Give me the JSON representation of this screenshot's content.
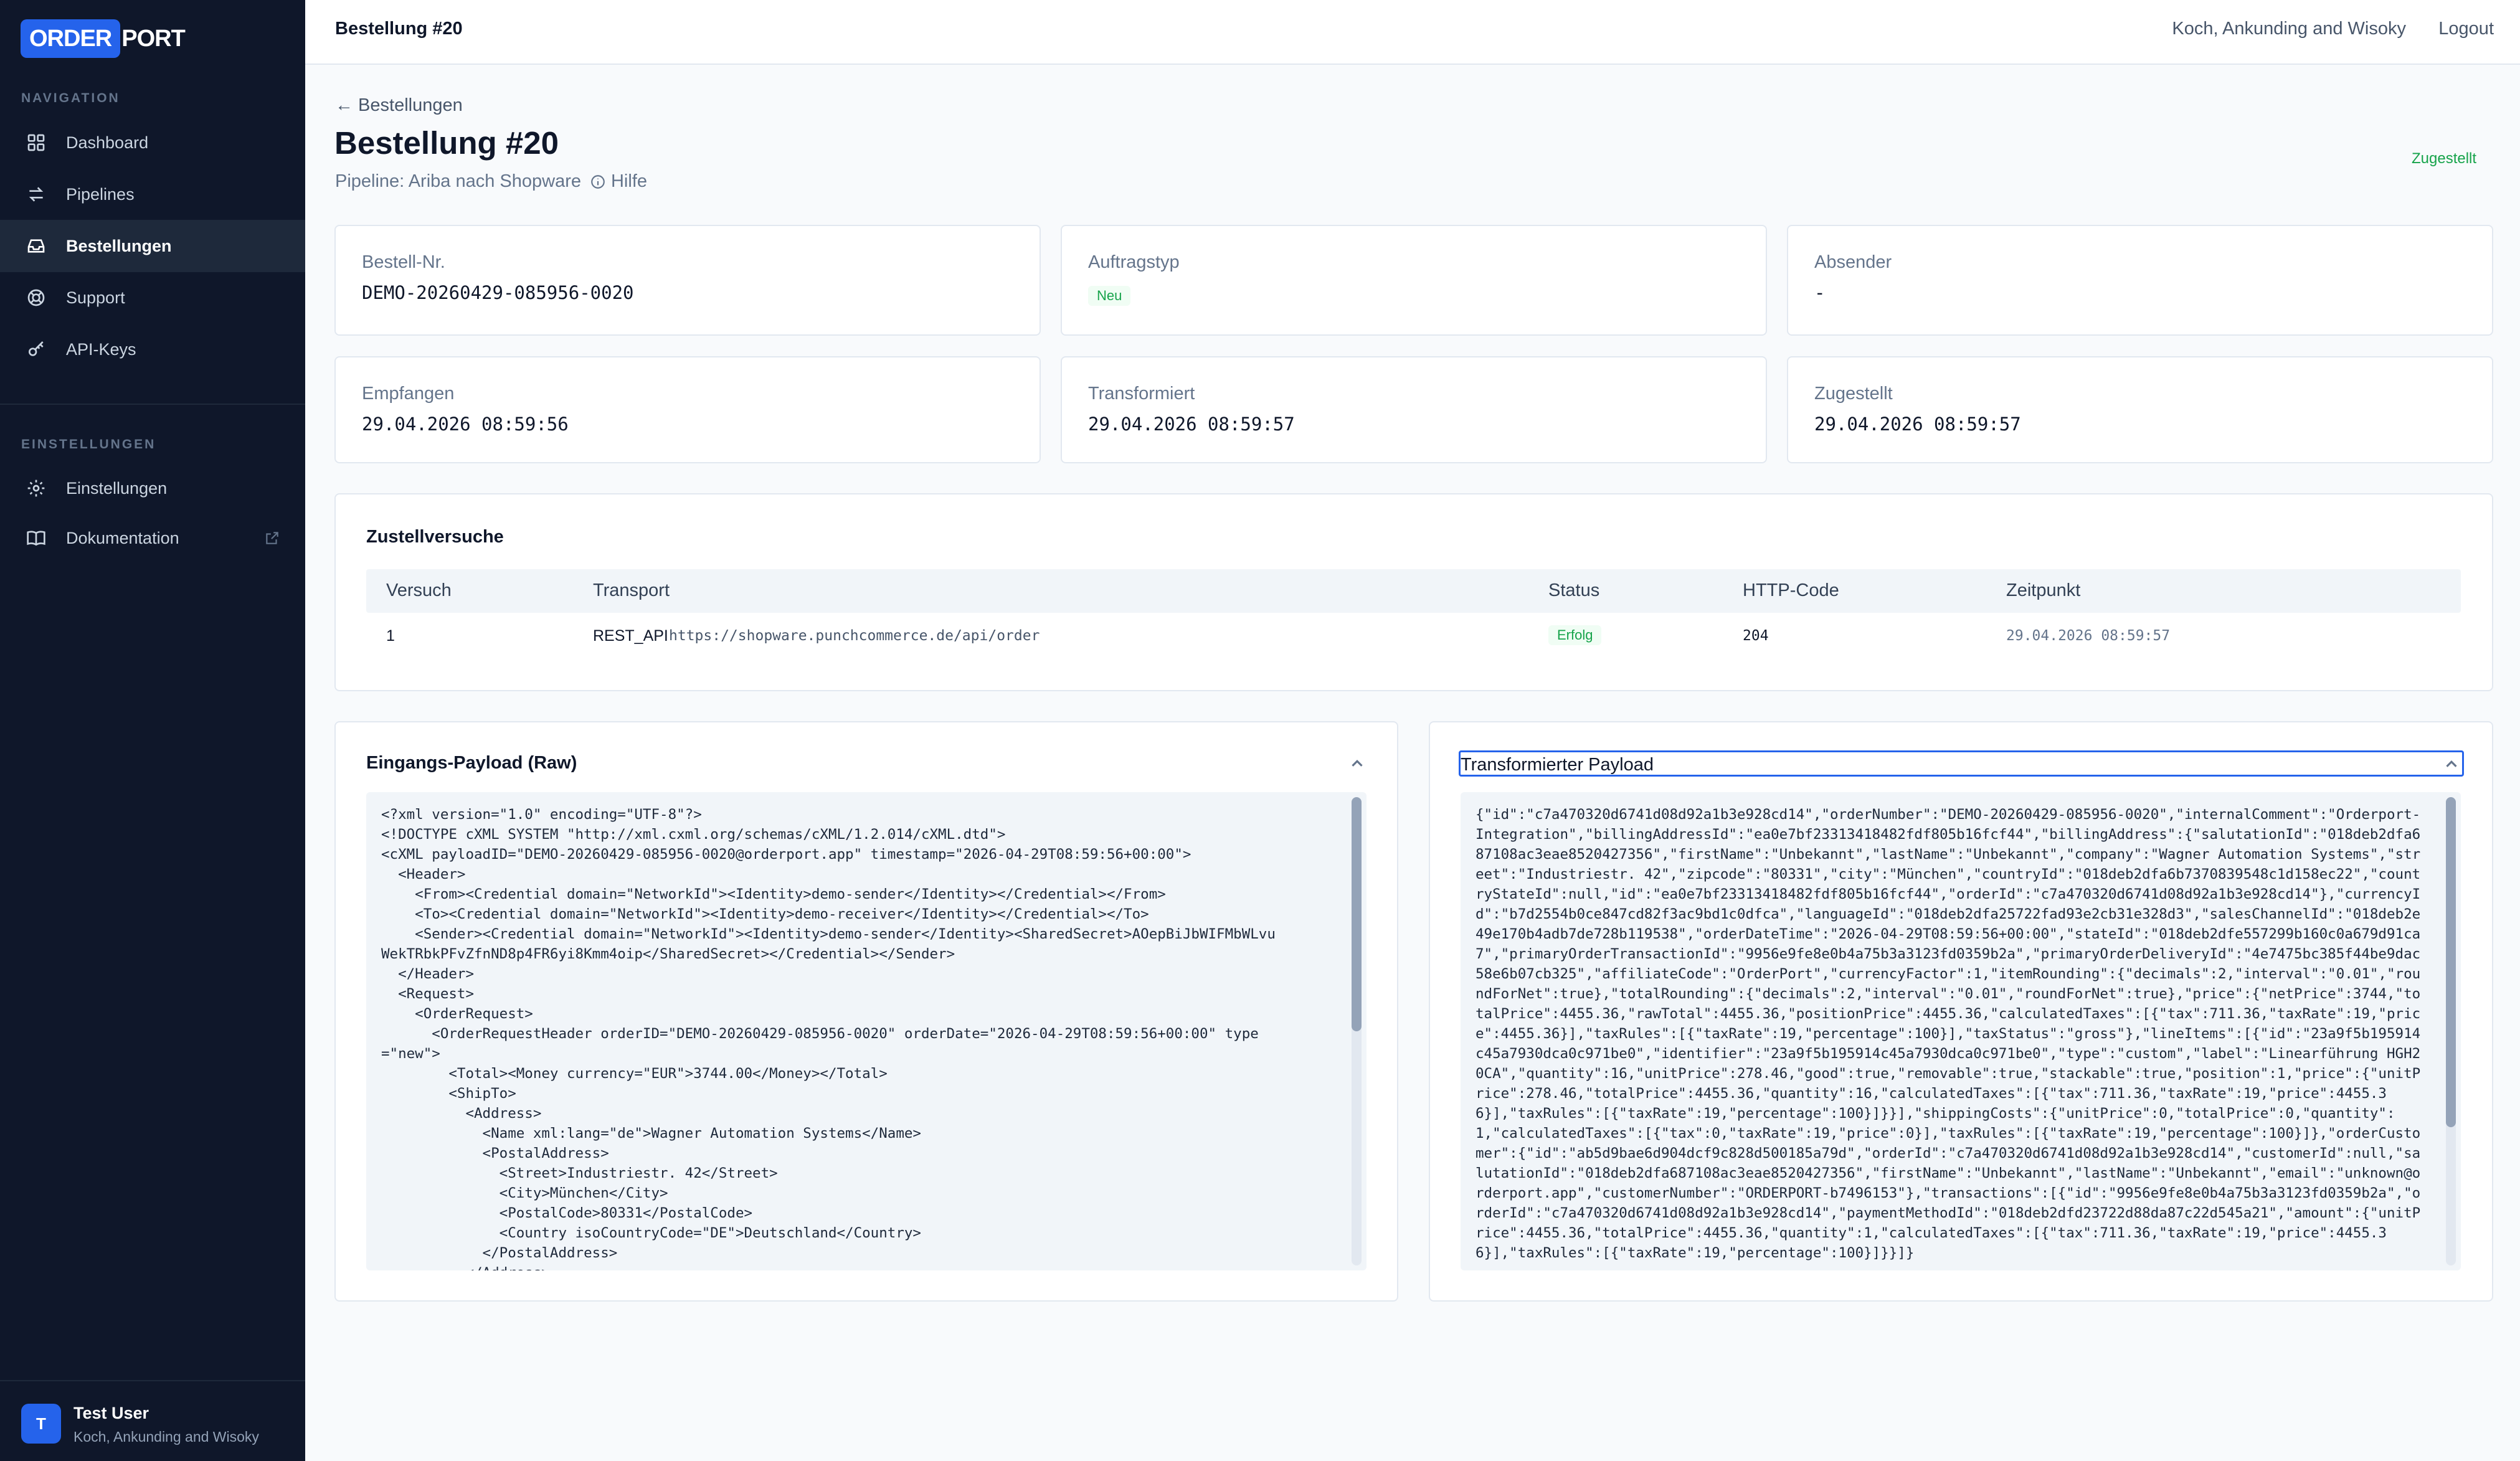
{
  "sidebar": {
    "logo_a": "ORDER",
    "logo_b": "PORT",
    "nav_title": "NAVIGATION",
    "nav": [
      {
        "label": "Dashboard",
        "icon": "grid-icon"
      },
      {
        "label": "Pipelines",
        "icon": "arrows-icon"
      },
      {
        "label": "Bestellungen",
        "icon": "inbox-icon"
      },
      {
        "label": "Support",
        "icon": "lifebuoy-icon"
      },
      {
        "label": "API-Keys",
        "icon": "key-icon"
      }
    ],
    "settings_title": "EINSTELLUNGEN",
    "settings": [
      {
        "label": "Einstellungen",
        "icon": "gear-icon"
      },
      {
        "label": "Dokumentation",
        "icon": "book-icon"
      }
    ],
    "user": {
      "initial": "T",
      "name": "Test User",
      "org": "Koch, Ankunding and Wisoky"
    }
  },
  "header": {
    "title": "Bestellung #20",
    "org": "Koch, Ankunding and Wisoky",
    "logout": "Logout"
  },
  "page": {
    "back": "← Bestellungen",
    "title": "Bestellung #20",
    "pipeline": "Pipeline: Ariba nach Shopware",
    "help": "Hilfe",
    "status": "Zugestellt",
    "status_color": "#16a34a"
  },
  "cards": {
    "order_no": {
      "label": "Bestell-Nr.",
      "value": "DEMO-20260429-085956-0020"
    },
    "type": {
      "label": "Auftragstyp",
      "value": "Neu"
    },
    "sender": {
      "label": "Absender",
      "value": "-"
    },
    "received": {
      "label": "Empfangen",
      "value": "29.04.2026 08:59:56"
    },
    "transformed": {
      "label": "Transformiert",
      "value": "29.04.2026 08:59:57"
    },
    "delivered": {
      "label": "Zugestellt",
      "value": "29.04.2026 08:59:57"
    }
  },
  "attempts": {
    "title": "Zustellversuche",
    "columns": [
      "Versuch",
      "Transport",
      "Status",
      "HTTP-Code",
      "Zeitpunkt"
    ],
    "rows": [
      {
        "attempt": "1",
        "transport": "REST_API",
        "url": "https://shopware.punchcommerce.de/api/order",
        "status": "Erfolg",
        "code": "204",
        "time": "29.04.2026 08:59:57"
      }
    ]
  },
  "raw": {
    "title": "Eingangs-Payload (Raw)",
    "content": "<?xml version=\"1.0\" encoding=\"UTF-8\"?>\n<!DOCTYPE cXML SYSTEM \"http://xml.cxml.org/schemas/cXML/1.2.014/cXML.dtd\">\n<cXML payloadID=\"DEMO-20260429-085956-0020@orderport.app\" timestamp=\"2026-04-29T08:59:56+00:00\">\n  <Header>\n    <From><Credential domain=\"NetworkId\"><Identity>demo-sender</Identity></Credential></From>\n    <To><Credential domain=\"NetworkId\"><Identity>demo-receiver</Identity></Credential></To>\n    <Sender><Credential domain=\"NetworkId\"><Identity>demo-sender</Identity><SharedSecret>AOepBiJbWIFMbWLvu\nWekTRbkPFvZfnND8p4FR6yi8Kmm4oip</SharedSecret></Credential></Sender>\n  </Header>\n  <Request>\n    <OrderRequest>\n      <OrderRequestHeader orderID=\"DEMO-20260429-085956-0020\" orderDate=\"2026-04-29T08:59:56+00:00\" type\n=\"new\">\n        <Total><Money currency=\"EUR\">3744.00</Money></Total>\n        <ShipTo>\n          <Address>\n            <Name xml:lang=\"de\">Wagner Automation Systems</Name>\n            <PostalAddress>\n              <Street>Industriestr. 42</Street>\n              <City>München</City>\n              <PostalCode>80331</PostalCode>\n              <Country isoCountryCode=\"DE\">Deutschland</Country>\n            </PostalAddress>\n          </Address>"
  },
  "transformed": {
    "title": "Transformierter Payload",
    "content": "{\"id\":\"c7a470320d6741d08d92a1b3e928cd14\",\"orderNumber\":\"DEMO-20260429-085956-0020\",\"internalComment\":\"Orderport-Integration\",\"billingAddressId\":\"ea0e7bf23313418482fdf805b16fcf44\",\"billingAddress\":{\"salutationId\":\"018deb2dfa687108ac3eae8520427356\",\"firstName\":\"Unbekannt\",\"lastName\":\"Unbekannt\",\"company\":\"Wagner Automation Systems\",\"street\":\"Industriestr. 42\",\"zipcode\":\"80331\",\"city\":\"München\",\"countryId\":\"018deb2dfa6b7370839548c1d158ec22\",\"countryStateId\":null,\"id\":\"ea0e7bf23313418482fdf805b16fcf44\",\"orderId\":\"c7a470320d6741d08d92a1b3e928cd14\"},\"currencyId\":\"b7d2554b0ce847cd82f3ac9bd1c0dfca\",\"languageId\":\"018deb2dfa25722fad93e2cb31e328d3\",\"salesChannelId\":\"018deb2e49e170b4adb7de728b119538\",\"orderDateTime\":\"2026-04-29T08:59:56+00:00\",\"stateId\":\"018deb2dfe557299b160c0a679d91ca7\",\"primaryOrderTransactionId\":\"9956e9fe8e0b4a75b3a3123fd0359b2a\",\"primaryOrderDeliveryId\":\"4e7475bc385f44be9dac58e6b07cb325\",\"affiliateCode\":\"OrderPort\",\"currencyFactor\":1,\"itemRounding\":{\"decimals\":2,\"interval\":\"0.01\",\"roundForNet\":true},\"totalRounding\":{\"decimals\":2,\"interval\":\"0.01\",\"roundForNet\":true},\"price\":{\"netPrice\":3744,\"totalPrice\":4455.36,\"rawTotal\":4455.36,\"positionPrice\":4455.36,\"calculatedTaxes\":[{\"tax\":711.36,\"taxRate\":19,\"price\":4455.36}],\"taxRules\":[{\"taxRate\":19,\"percentage\":100}],\"taxStatus\":\"gross\"},\"lineItems\":[{\"id\":\"23a9f5b195914c45a7930dca0c971be0\",\"identifier\":\"23a9f5b195914c45a7930dca0c971be0\",\"type\":\"custom\",\"label\":\"Linearführung HGH20CA\",\"quantity\":16,\"unitPrice\":278.46,\"good\":true,\"removable\":true,\"stackable\":true,\"position\":1,\"price\":{\"unitPrice\":278.46,\"totalPrice\":4455.36,\"quantity\":16,\"calculatedTaxes\":[{\"tax\":711.36,\"taxRate\":19,\"price\":4455.36}],\"taxRules\":[{\"taxRate\":19,\"percentage\":100}]}}],\"shippingCosts\":{\"unitPrice\":0,\"totalPrice\":0,\"quantity\":1,\"calculatedTaxes\":[{\"tax\":0,\"taxRate\":19,\"price\":0}],\"taxRules\":[{\"taxRate\":19,\"percentage\":100}]},\"orderCustomer\":{\"id\":\"ab5d9bae6d904dcf9c828d500185a79d\",\"orderId\":\"c7a470320d6741d08d92a1b3e928cd14\",\"customerId\":null,\"salutationId\":\"018deb2dfa687108ac3eae8520427356\",\"firstName\":\"Unbekannt\",\"lastName\":\"Unbekannt\",\"email\":\"unknown@orderport.app\",\"customerNumber\":\"ORDERPORT-b7496153\"},\"transactions\":[{\"id\":\"9956e9fe8e0b4a75b3a3123fd0359b2a\",\"orderId\":\"c7a470320d6741d08d92a1b3e928cd14\",\"paymentMethodId\":\"018deb2dfd23722d88da87c22d545a21\",\"amount\":{\"unitPrice\":4455.36,\"totalPrice\":4455.36,\"quantity\":1,\"calculatedTaxes\":[{\"tax\":711.36,\"taxRate\":19,\"price\":4455.36}],\"taxRules\":[{\"taxRate\":19,\"percentage\":100}]}}]}"
  }
}
